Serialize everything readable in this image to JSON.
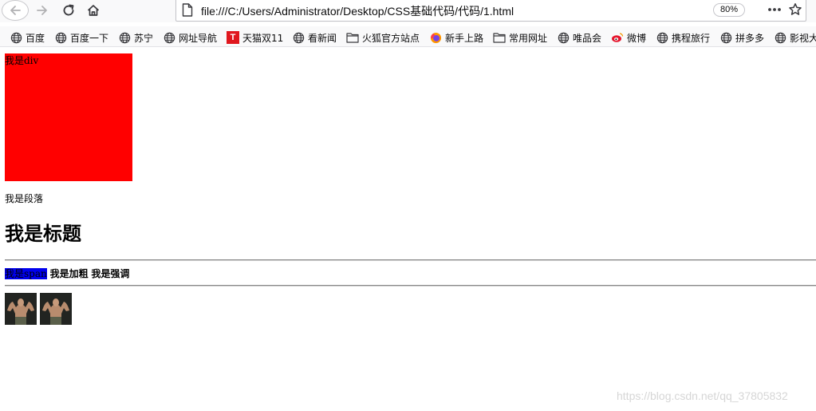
{
  "browser": {
    "url": "file:///C:/Users/Administrator/Desktop/CSS基础代码/代码/1.html",
    "zoom": "80%"
  },
  "bookmarks": [
    {
      "label": "百度",
      "icon": "globe-icon"
    },
    {
      "label": "百度一下",
      "icon": "globe-icon"
    },
    {
      "label": "苏宁",
      "icon": "globe-icon"
    },
    {
      "label": "网址导航",
      "icon": "globe-icon"
    },
    {
      "label": "天猫双11",
      "icon": "tmall-icon",
      "icon_text": "T",
      "color": "#e0171e"
    },
    {
      "label": "看新闻",
      "icon": "globe-icon"
    },
    {
      "label": "火狐官方站点",
      "icon": "folder-icon"
    },
    {
      "label": "新手上路",
      "icon": "firefox-icon"
    },
    {
      "label": "常用网址",
      "icon": "folder-icon"
    },
    {
      "label": "唯品会",
      "icon": "globe-icon"
    },
    {
      "label": "微博",
      "icon": "weibo-icon"
    },
    {
      "label": "携程旅行",
      "icon": "globe-icon"
    },
    {
      "label": "拼多多",
      "icon": "globe-icon"
    },
    {
      "label": "影视大",
      "icon": "globe-icon"
    }
  ],
  "page": {
    "div_text": "我是div",
    "div_color": "#ff0000",
    "paragraph": "我是段落",
    "heading": "我是标题",
    "span_text": "我是span",
    "span_color": "#0000ee",
    "bold_text": "我是加粗",
    "strong_text": "我是强调",
    "image_count": 2
  },
  "watermark": "https://blog.csdn.net/qq_37805832"
}
